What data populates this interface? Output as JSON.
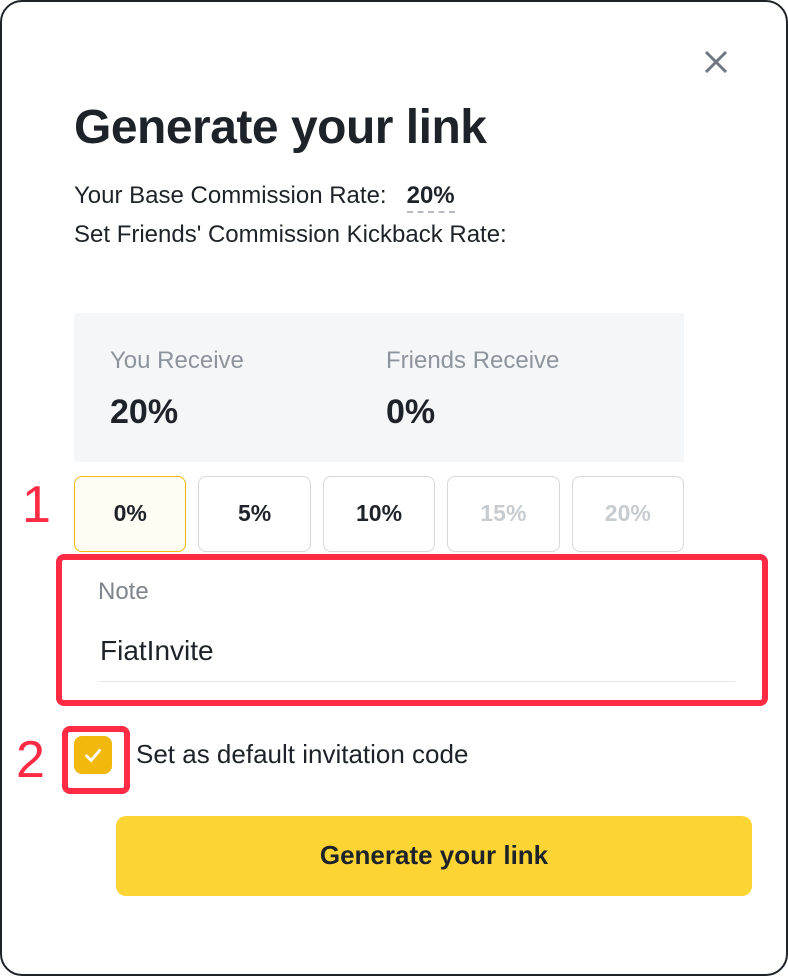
{
  "title": "Generate your link",
  "base_rate_label": "Your Base Commission Rate:",
  "base_rate_value": "20%",
  "kickback_label": "Set Friends' Commission Kickback Rate:",
  "receive": {
    "you_label": "You Receive",
    "you_value": "20%",
    "friends_label": "Friends Receive",
    "friends_value": "0%"
  },
  "options": {
    "o0": "0%",
    "o1": "5%",
    "o2": "10%",
    "o3": "15%",
    "o4": "20%"
  },
  "note": {
    "label": "Note",
    "value": "FiatInvite"
  },
  "default_label": "Set as default invitation code",
  "generate_btn": "Generate your link",
  "annotations": {
    "a1": "1",
    "a2": "2"
  }
}
